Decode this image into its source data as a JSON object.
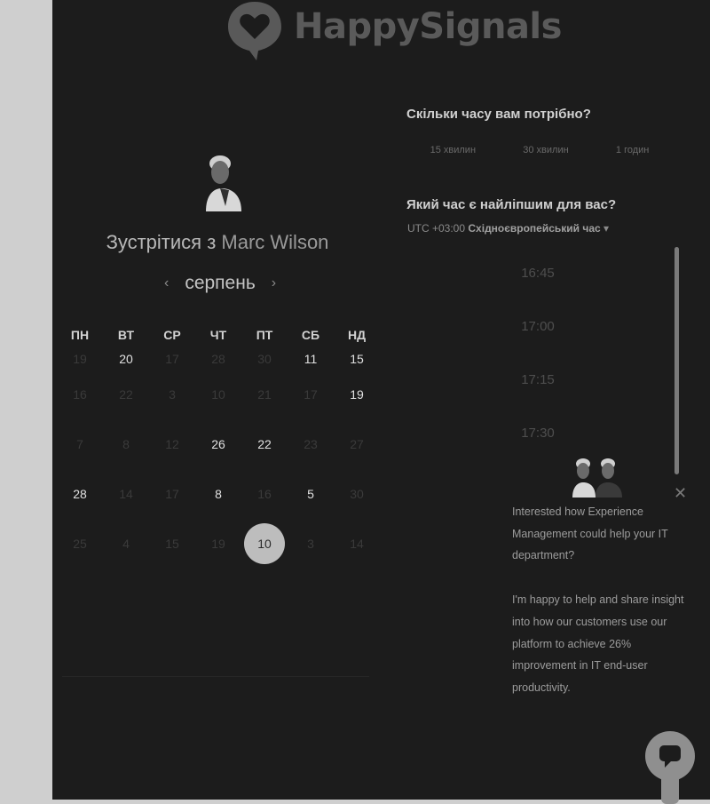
{
  "logo": {
    "text": "HappySignals"
  },
  "host": {
    "meet_prefix": "Зустрітися з",
    "name": "Marc Wilson"
  },
  "calendar": {
    "month": "серпень",
    "prev_arrow": "‹",
    "next_arrow": "›",
    "weekdays": [
      "ПН",
      "ВТ",
      "СР",
      "ЧТ",
      "ПТ",
      "СБ",
      "НД"
    ],
    "rows": [
      [
        {
          "d": "19",
          "on": false
        },
        {
          "d": "20",
          "on": true
        },
        {
          "d": "17",
          "on": false
        },
        {
          "d": "28",
          "on": false
        },
        {
          "d": "30",
          "on": false
        },
        {
          "d": "11",
          "on": true
        },
        {
          "d": "15",
          "on": true
        }
      ],
      [
        {
          "d": "16",
          "on": false
        },
        {
          "d": "22",
          "on": false
        },
        {
          "d": "3",
          "on": false
        },
        {
          "d": "10",
          "on": false
        },
        {
          "d": "21",
          "on": false
        },
        {
          "d": "17",
          "on": false
        },
        {
          "d": "19",
          "on": true
        }
      ],
      [
        {
          "d": "7",
          "on": false
        },
        {
          "d": "8",
          "on": false
        },
        {
          "d": "12",
          "on": false
        },
        {
          "d": "26",
          "on": true
        },
        {
          "d": "22",
          "on": true
        },
        {
          "d": "23",
          "on": false
        },
        {
          "d": "27",
          "on": false
        }
      ],
      [
        {
          "d": "28",
          "on": true
        },
        {
          "d": "14",
          "on": false
        },
        {
          "d": "17",
          "on": false
        },
        {
          "d": "8",
          "on": true
        },
        {
          "d": "16",
          "on": false
        },
        {
          "d": "5",
          "on": true
        },
        {
          "d": "30",
          "on": false
        }
      ],
      [
        {
          "d": "25",
          "on": false
        },
        {
          "d": "4",
          "on": false
        },
        {
          "d": "15",
          "on": false
        },
        {
          "d": "19",
          "on": false
        },
        {
          "d": "10",
          "on": true,
          "selected": true
        },
        {
          "d": "3",
          "on": false
        },
        {
          "d": "14",
          "on": false
        }
      ]
    ]
  },
  "duration": {
    "question": "Скільки часу вам потрібно?",
    "options": [
      "15 хвилин",
      "30 хвилин",
      "1 годин"
    ]
  },
  "time": {
    "question": "Який час є найліпшим для вас?",
    "tz_offset": "UTC +03:00",
    "tz_name": "Східноєвропейський час",
    "dropdown_icon": "▾",
    "slots": [
      "16:45",
      "17:00",
      "17:15",
      "17:30"
    ]
  },
  "chat": {
    "close": "✕",
    "message1": "Interested how Experience Management could help your IT department?",
    "message2": "I'm happy to help and share insight into how our customers use our platform to achieve 26% improvement in IT end-user productivity."
  },
  "colors": {
    "panel_bg": "#1c1c1c",
    "outer_bg": "#cfcfcf",
    "selected_day": "#bdbdbd"
  }
}
